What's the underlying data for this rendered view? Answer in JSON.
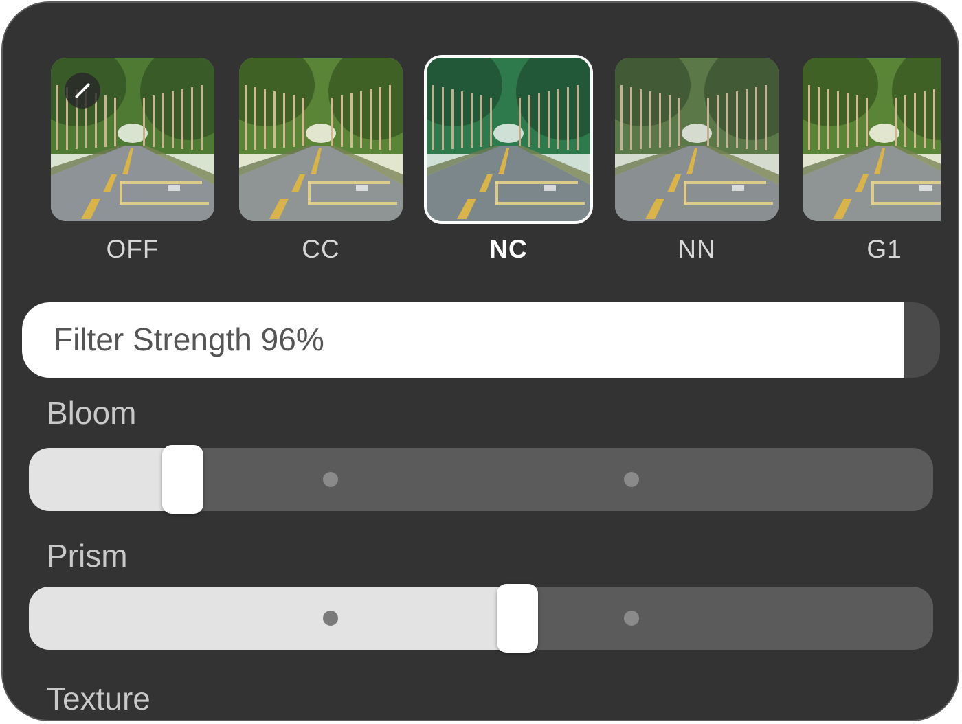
{
  "filters": [
    {
      "label": "OFF",
      "selected": false,
      "tone": "natural",
      "has_edit_icon": true
    },
    {
      "label": "CC",
      "selected": false,
      "tone": "warm"
    },
    {
      "label": "NC",
      "selected": true,
      "tone": "cool-green"
    },
    {
      "label": "NN",
      "selected": false,
      "tone": "muted"
    },
    {
      "label": "G1",
      "selected": false,
      "tone": "warm"
    }
  ],
  "edit_icon": "pencil-icon",
  "strength": {
    "label": "Filter Strength 96%",
    "value": 0.96
  },
  "sliders": {
    "bloom": {
      "label": "Bloom",
      "value": 0.17,
      "tick_positions": [
        0.3333,
        0.6667
      ]
    },
    "prism": {
      "label": "Prism",
      "value": 0.54,
      "tick_positions": [
        0.3333,
        0.6667
      ]
    }
  },
  "texture": {
    "label": "Texture"
  },
  "colors": {
    "panel": "#333333",
    "track": "#5b5b5b",
    "fill": "#e3e3e3",
    "selected_border": "#ffffff"
  }
}
